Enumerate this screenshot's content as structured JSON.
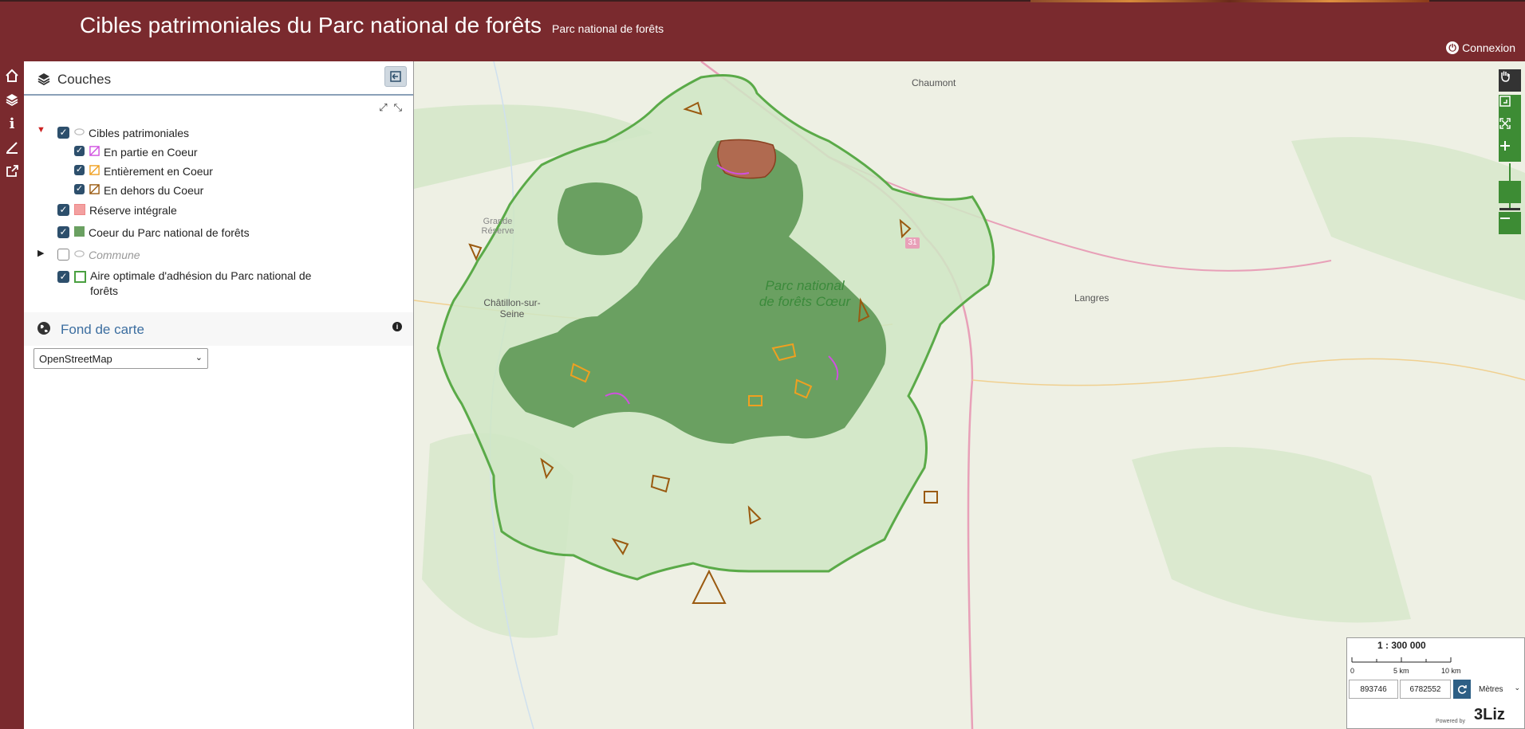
{
  "header": {
    "title": "Cibles patrimoniales du Parc national de forêts",
    "subtitle": "Parc national de forêts",
    "login_label": "Connexion"
  },
  "rail": {
    "items": [
      "home-icon",
      "layers-icon",
      "info-icon",
      "measure-icon",
      "share-icon"
    ]
  },
  "panel": {
    "title": "Couches",
    "layers": [
      {
        "label": "Cibles patrimoniales",
        "checked": true
      },
      {
        "label": "En partie en Coeur",
        "checked": true,
        "color": "#d050e0"
      },
      {
        "label": "Entièrement en Coeur",
        "checked": true,
        "color": "#f0a020"
      },
      {
        "label": "En dehors du Coeur",
        "checked": true,
        "color": "#9a5a10"
      },
      {
        "label": "Réserve intégrale",
        "checked": true,
        "color": "#f3a0a0"
      },
      {
        "label": "Coeur du Parc national de forêts",
        "checked": true,
        "color": "#6aa061"
      },
      {
        "label": "Commune",
        "checked": false
      },
      {
        "label": "Aire optimale d'adhésion du Parc national de",
        "label2": "forêts",
        "checked": true,
        "color": "#4aa040"
      }
    ],
    "basemap_title": "Fond de carte",
    "basemap_value": "OpenStreetMap"
  },
  "map": {
    "labels": {
      "chaumont": "Chaumont",
      "grande_reserve": "Grande Réserve",
      "chatillon": "Châtillon-sur-Seine",
      "langres": "Langres",
      "road": "31",
      "park": "Parc national de forêts Cœur"
    }
  },
  "scale": {
    "ratio": "1 : 300 000",
    "ticks": [
      "0",
      "5 km",
      "10 km"
    ],
    "x": "893746",
    "y": "6782552",
    "units": "Mètres"
  },
  "footer": {
    "powered": "Powered by",
    "logo": "3Liz"
  }
}
